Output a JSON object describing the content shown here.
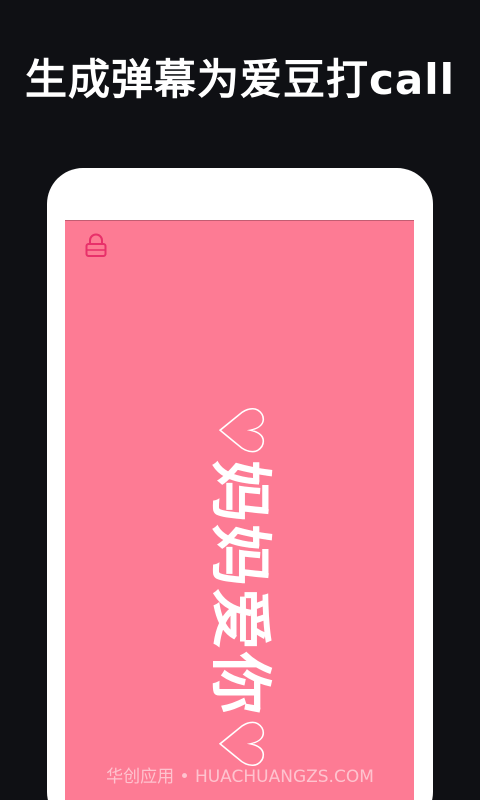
{
  "header": {
    "headline": "生成弹幕为爱豆打call"
  },
  "preview": {
    "lock_icon": "lock-icon",
    "barrage_text": "♡妈妈爱你♡",
    "background_color": "#fd7b94",
    "text_color": "#ffffff",
    "lock_color": "#e8306a"
  },
  "footer": {
    "watermark": "华创应用 • HUACHUANGZS.COM"
  }
}
